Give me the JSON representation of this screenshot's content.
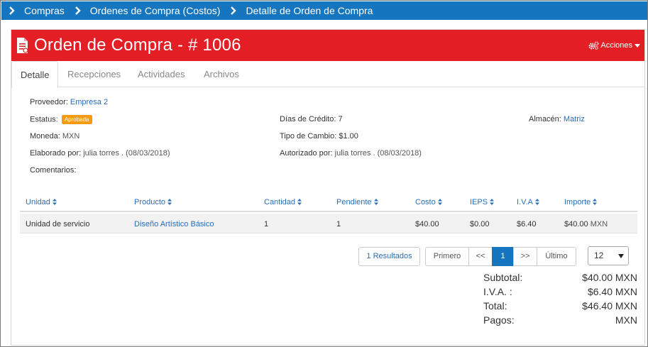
{
  "breadcrumb": {
    "items": [
      {
        "label": "Compras"
      },
      {
        "label": "Ordenes de Compra (Costos)"
      },
      {
        "label": "Detalle de Orden de Compra"
      }
    ]
  },
  "header": {
    "title": "Orden de Compra - # 1006",
    "actions_label": "Acciones",
    "color": "#e31e25"
  },
  "tabs": [
    {
      "label": "Detalle",
      "active": true
    },
    {
      "label": "Recepciones"
    },
    {
      "label": "Actividades"
    },
    {
      "label": "Archivos"
    }
  ],
  "details": {
    "proveedor_label": "Proveedor:",
    "proveedor_value": "Empresa 2",
    "estatus_label": "Estatus:",
    "estatus_badge": "Aprobada",
    "dias_credito_label": "Días de Crédito:",
    "dias_credito_value": "7",
    "almacen_label": "Almacén:",
    "almacen_value": "Matriz",
    "moneda_label": "Moneda:",
    "moneda_value": "MXN",
    "tipo_cambio_label": "Tipo de Cambio:",
    "tipo_cambio_value": "$1.00",
    "elaborado_label": "Elaborado por:",
    "elaborado_value": "julia torres . (08/03/2018)",
    "autorizado_label": "Autorizado por:",
    "autorizado_value": "julia torres . (08/03/2018)",
    "comentarios_label": "Comentarios:"
  },
  "table": {
    "columns": [
      "Unidad",
      "Producto",
      "Cantidad",
      "Pendiente",
      "Costo",
      "IEPS",
      "I.V.A",
      "Importe"
    ],
    "rows": [
      {
        "unidad": "Unidad de servicio",
        "producto": "Diseño Artístico Básico",
        "cantidad": "1",
        "pendiente": "1",
        "costo": "$40.00",
        "ieps": "$0.00",
        "iva": "$6.40",
        "importe": "$40.00",
        "moneda": "MXN"
      }
    ]
  },
  "pagination": {
    "results": "1 Resultados",
    "first": "Primero",
    "prev": "<<",
    "current": "1",
    "next": ">>",
    "last": "Último",
    "page_size": "12"
  },
  "totals": {
    "subtotal_label": "Subtotal:",
    "subtotal_value": "$40.00 MXN",
    "iva_label": "I.V.A. :",
    "iva_value": "$6.40 MXN",
    "total_label": "Total:",
    "total_value": "$46.40 MXN",
    "pagos_label": "Pagos:",
    "pagos_value": "MXN"
  }
}
